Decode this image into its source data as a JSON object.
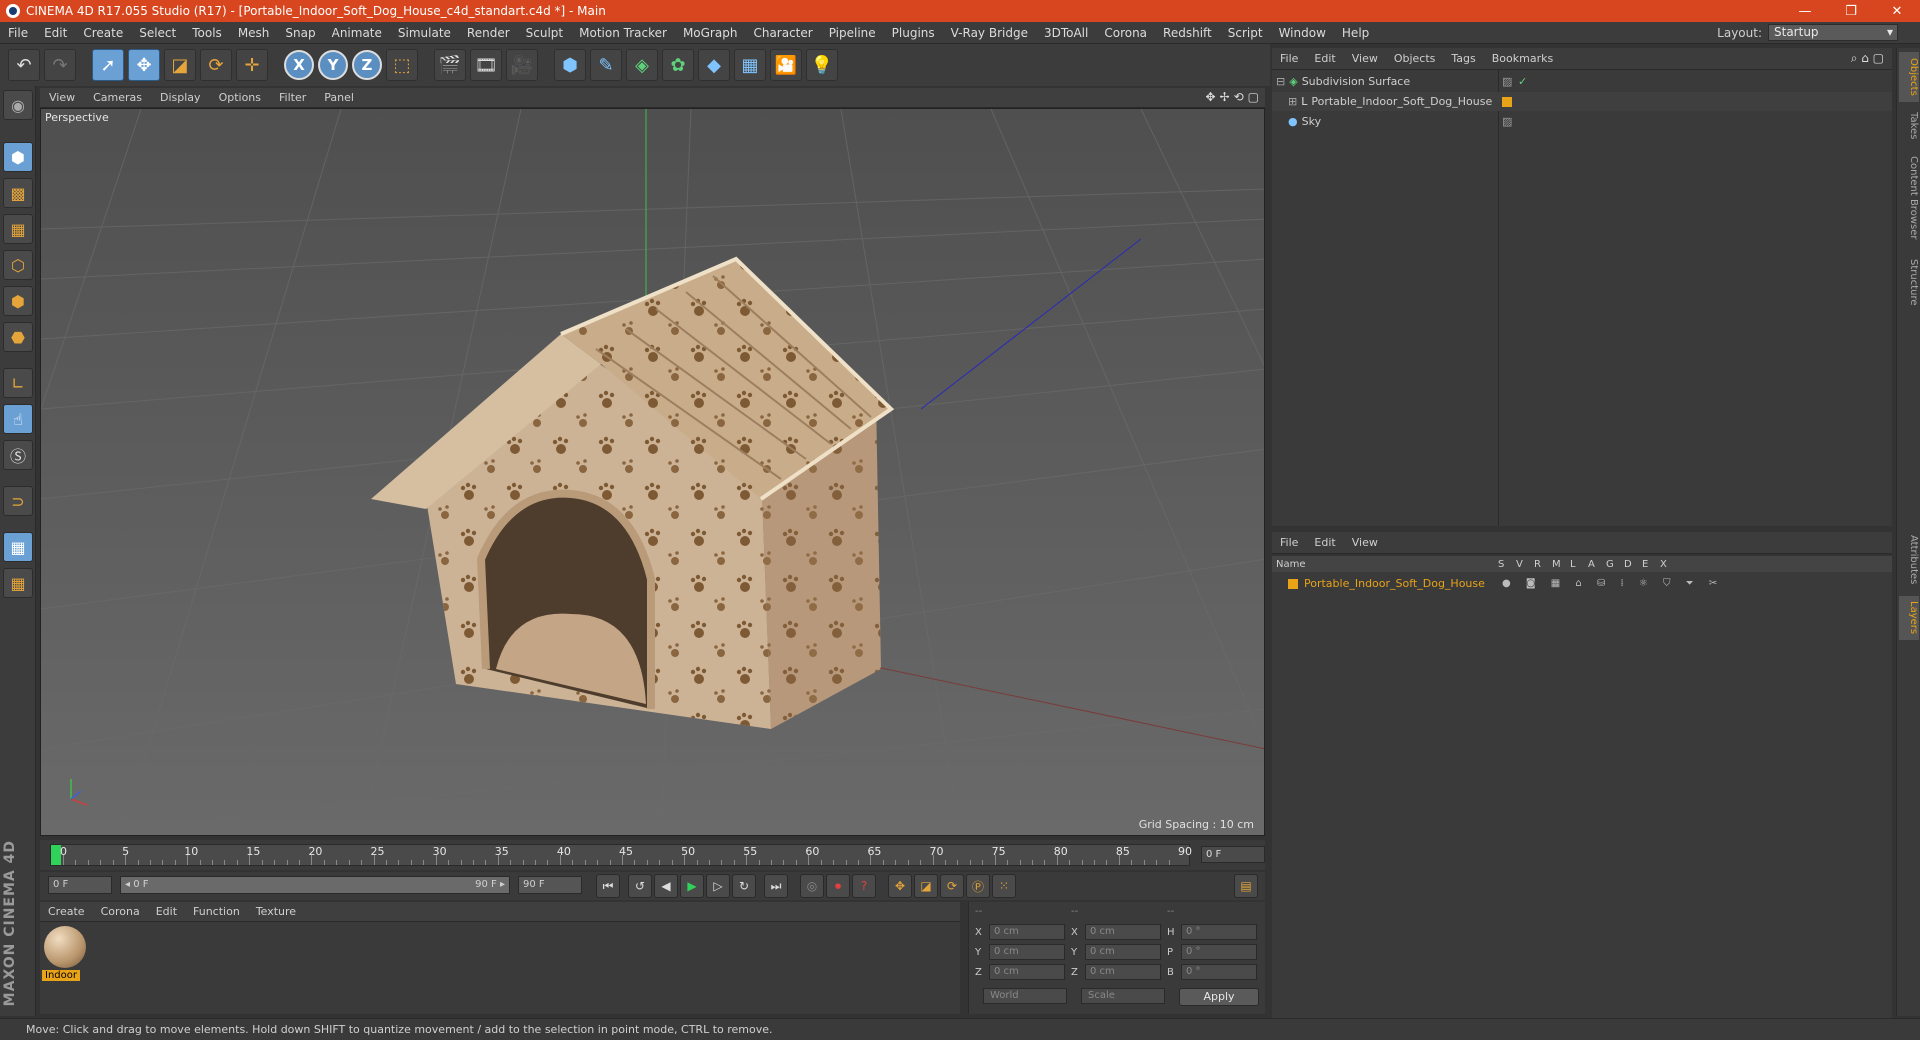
{
  "window": {
    "title": "CINEMA 4D R17.055 Studio (R17) - [Portable_Indoor_Soft_Dog_House_c4d_standart.c4d *] - Main",
    "controls": [
      "—",
      "❐",
      "✕"
    ]
  },
  "menubar": {
    "items": [
      "File",
      "Edit",
      "Create",
      "Select",
      "Tools",
      "Mesh",
      "Snap",
      "Animate",
      "Simulate",
      "Render",
      "Sculpt",
      "Motion Tracker",
      "MoGraph",
      "Character",
      "Pipeline",
      "Plugins",
      "V-Ray Bridge",
      "3DToAll",
      "Corona",
      "Redshift",
      "Script",
      "Window",
      "Help"
    ],
    "layout_label": "Layout:",
    "layout_value": "Startup"
  },
  "viewport": {
    "menu": [
      "View",
      "Cameras",
      "Display",
      "Options",
      "Filter",
      "Panel"
    ],
    "label": "Perspective",
    "grid_spacing": "Grid Spacing : 10 cm",
    "nav_icons": [
      "✥",
      "✢",
      "⟲",
      "▢"
    ]
  },
  "timeline": {
    "ticks": [
      "0",
      "5",
      "10",
      "15",
      "20",
      "25",
      "30",
      "35",
      "40",
      "45",
      "50",
      "55",
      "60",
      "65",
      "70",
      "75",
      "80",
      "85",
      "90"
    ],
    "current_frame": "0 F"
  },
  "transport": {
    "start_field": "0 F",
    "range_start": "◂ 0 F",
    "range_end": "90 F ▸",
    "end_field": "90 F"
  },
  "material_manager": {
    "menu": [
      "Create",
      "Corona",
      "Edit",
      "Function",
      "Texture"
    ],
    "material_name": "Indoor"
  },
  "coordinates": {
    "headers": [
      "--",
      "--",
      "--"
    ],
    "rows": [
      {
        "a": "X",
        "av": "0 cm",
        "b": "X",
        "bv": "0 cm",
        "c": "H",
        "cv": "0 °"
      },
      {
        "a": "Y",
        "av": "0 cm",
        "b": "Y",
        "bv": "0 cm",
        "c": "P",
        "cv": "0 °"
      },
      {
        "a": "Z",
        "av": "0 cm",
        "b": "Z",
        "bv": "0 cm",
        "c": "B",
        "cv": "0 °"
      }
    ],
    "space_dropdown": "World",
    "mode_dropdown": "Scale",
    "apply_label": "Apply"
  },
  "statusbar": {
    "text": "Move: Click and drag to move elements. Hold down SHIFT to quantize movement / add to the selection in point mode, CTRL to remove."
  },
  "brand": "MAXON CINEMA 4D",
  "object_manager": {
    "menu": [
      "File",
      "Edit",
      "View",
      "Objects",
      "Tags",
      "Bookmarks"
    ],
    "objects": [
      {
        "name": "Subdivision Surface",
        "icon": "subdivision-icon",
        "indent": 0
      },
      {
        "name": "Portable_Indoor_Soft_Dog_House",
        "icon": "null-icon",
        "indent": 1
      },
      {
        "name": "Sky",
        "icon": "sky-icon",
        "indent": 0
      }
    ]
  },
  "layer_manager": {
    "menu": [
      "File",
      "Edit",
      "View"
    ],
    "columns": [
      "Name",
      "S",
      "V",
      "R",
      "M",
      "L",
      "A",
      "G",
      "D",
      "E",
      "X"
    ],
    "layers": [
      {
        "name": "Portable_Indoor_Soft_Dog_House",
        "color": "#e8a318"
      }
    ]
  },
  "side_tabs": [
    "Objects",
    "Takes",
    "Content Browser",
    "Structure",
    "Attributes",
    "Layers"
  ],
  "colors": {
    "titlebar": "#d7461f",
    "accent_orange": "#e8a318",
    "selection_blue": "#6aa0d4"
  }
}
